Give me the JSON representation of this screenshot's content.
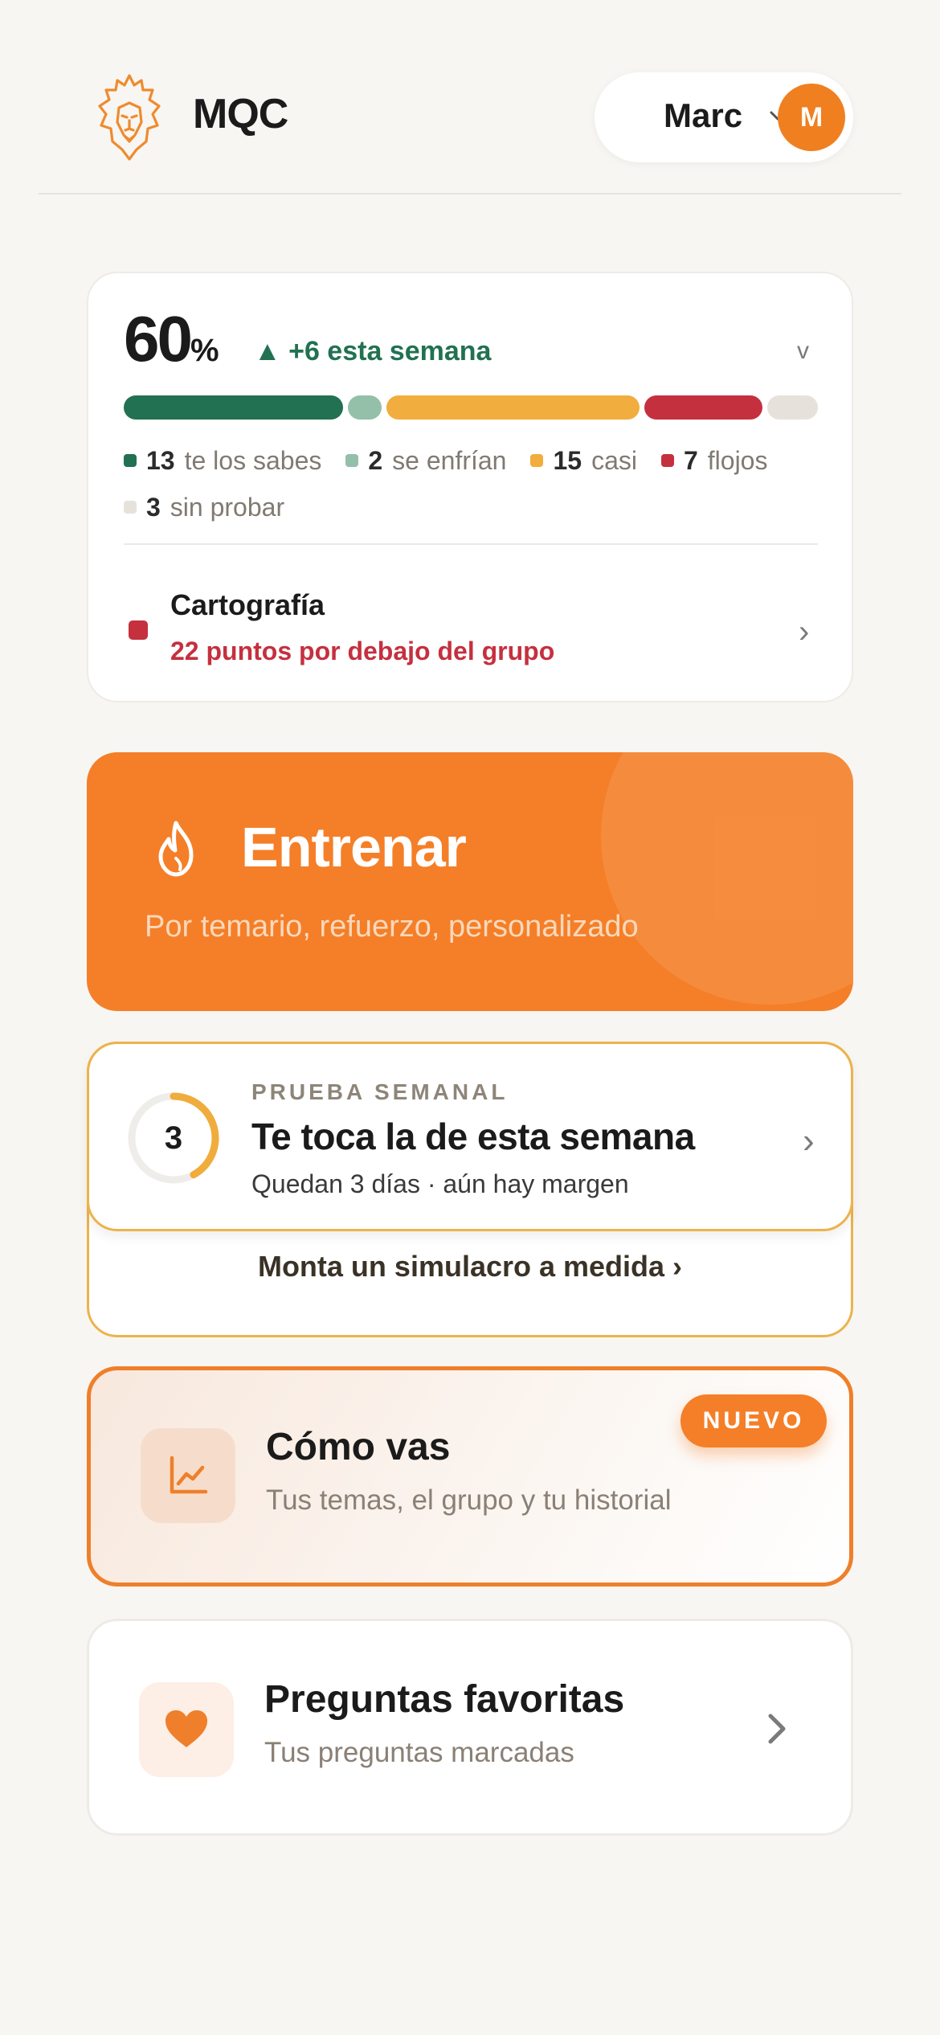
{
  "header": {
    "brand": "MQC",
    "user_name": "Marc",
    "avatar_initial": "M"
  },
  "progress": {
    "percent": "60",
    "percent_sign": "%",
    "delta": "▲ +6 esta semana",
    "expand_glyph": "v",
    "segments": [
      {
        "key": "known",
        "count": 13,
        "color": "#217152"
      },
      {
        "key": "cooling",
        "count": 2,
        "color": "#94bfa9"
      },
      {
        "key": "almost",
        "count": 15,
        "color": "#f1ad3d"
      },
      {
        "key": "weak",
        "count": 7,
        "color": "#c5303f"
      },
      {
        "key": "untried",
        "count": 3,
        "color": "#e6e2db"
      }
    ],
    "legend": {
      "known_num": "13",
      "known_label": "te los sabes",
      "cooling_num": "2",
      "cooling_label": "se enfrían",
      "almost_num": "15",
      "almost_label": "casi",
      "weak_num": "7",
      "weak_label": "flojos",
      "untried_num": "3",
      "untried_label": "sin probar"
    },
    "weak_topic": {
      "title": "Cartografía",
      "subtitle": "22 puntos por debajo del grupo"
    }
  },
  "train": {
    "title": "Entrenar",
    "subtitle": "Por temario, refuerzo, personalizado"
  },
  "weekly": {
    "days_left": "3",
    "ring_fraction": 0.42,
    "label": "PRUEBA SEMANAL",
    "title": "Te toca la de esta semana",
    "subtitle": "Quedan 3 días · aún hay margen",
    "simulacro": "Monta un simulacro a medida  ›"
  },
  "como_vas": {
    "title": "Cómo vas",
    "subtitle": "Tus temas, el grupo y tu historial",
    "badge": "NUEVO",
    "icon": "chart-line-icon"
  },
  "favoritas": {
    "title": "Preguntas favoritas",
    "subtitle": "Tus preguntas marcadas",
    "icon": "heart-icon"
  },
  "colors": {
    "accent": "#f47f28",
    "background": "#f8f6f2",
    "weak": "#c5303f",
    "positive": "#217152"
  }
}
